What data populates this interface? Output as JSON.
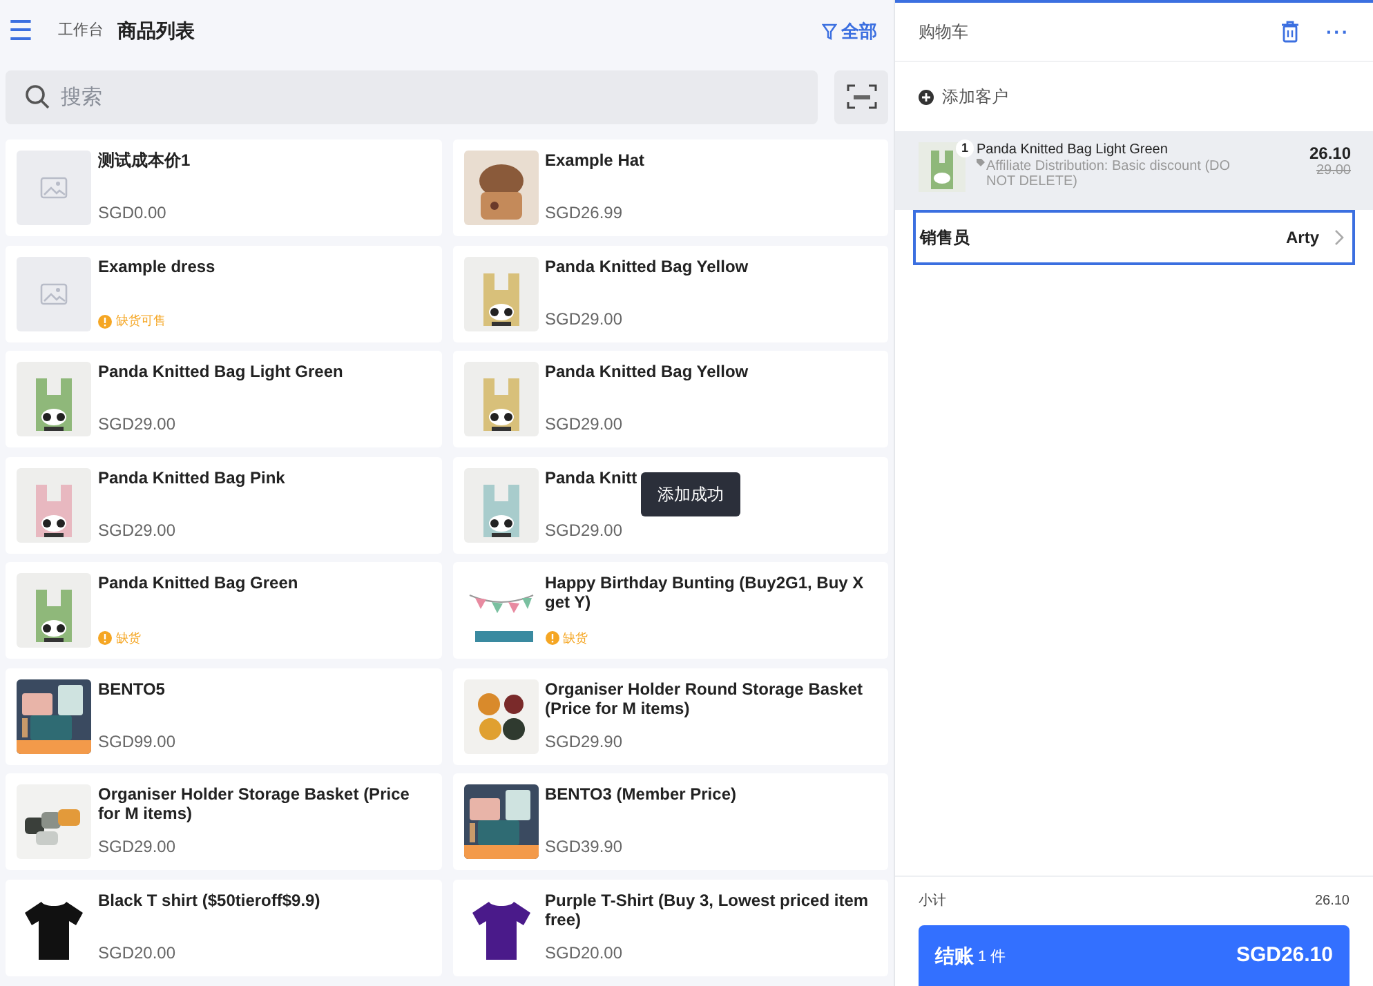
{
  "header": {
    "menu_icon": "☰",
    "breadcrumb": "工作台",
    "title": "商品列表",
    "filter": "全部"
  },
  "search": {
    "placeholder": "搜索"
  },
  "products": [
    {
      "name": "测试成本价1",
      "price": "SGD0.00",
      "kind": "placeholder"
    },
    {
      "name": "Example Hat",
      "price": "SGD26.99",
      "kind": "picture"
    },
    {
      "name": "Example dress",
      "stock_status": "缺货可售",
      "kind": "placeholder"
    },
    {
      "name": "Panda Knitted Bag Yellow",
      "price": "SGD29.00",
      "kind": "picture"
    },
    {
      "name": "Panda Knitted Bag Light Green",
      "price": "SGD29.00",
      "kind": "picture"
    },
    {
      "name": "Panda Knitted Bag Yellow",
      "price": "SGD29.00",
      "kind": "picture"
    },
    {
      "name": "Panda Knitted Bag Pink",
      "price": "SGD29.00",
      "kind": "picture"
    },
    {
      "name": "Panda Knitt",
      "price": "SGD29.00",
      "kind": "picture"
    },
    {
      "name": "Panda Knitted Bag Green",
      "stock_status": "缺货",
      "kind": "picture"
    },
    {
      "name": "Happy Birthday Bunting (Buy2G1, Buy X get Y)",
      "stock_status": "缺货",
      "kind": "picture"
    },
    {
      "name": "BENTO5",
      "price": "SGD99.00",
      "kind": "picture"
    },
    {
      "name": "Organiser Holder Round Storage Basket (Price for M items)",
      "price": "SGD29.90",
      "kind": "picture"
    },
    {
      "name": "Organiser Holder Storage Basket (Price for M items)",
      "price": "SGD29.00",
      "kind": "picture"
    },
    {
      "name": "BENTO3 (Member Price)",
      "price": "SGD39.90",
      "kind": "picture"
    },
    {
      "name": "Black T shirt ($50tieroff$9.9)",
      "price": "SGD20.00",
      "kind": "picture"
    },
    {
      "name": "Purple T-Shirt (Buy 3, Lowest priced item free)",
      "price": "SGD20.00",
      "kind": "picture"
    }
  ],
  "toast": "添加成功",
  "cart": {
    "title": "购物车",
    "more": "···",
    "add_customer": "添加客户",
    "items": [
      {
        "quantity": "1",
        "name": "Panda Knitted Bag Light Green",
        "discount": "Affiliate Distribution: Basic discount (DO NOT DELETE)",
        "price": "26.10",
        "original_price": "29.00",
        "selected": true
      }
    ],
    "salesperson": {
      "label": "销售员",
      "value": "Arty"
    },
    "subtotal": {
      "label": "小计",
      "value": "26.10"
    },
    "checkout": {
      "label": "结账",
      "count": "1 件",
      "total": "SGD26.10"
    }
  }
}
